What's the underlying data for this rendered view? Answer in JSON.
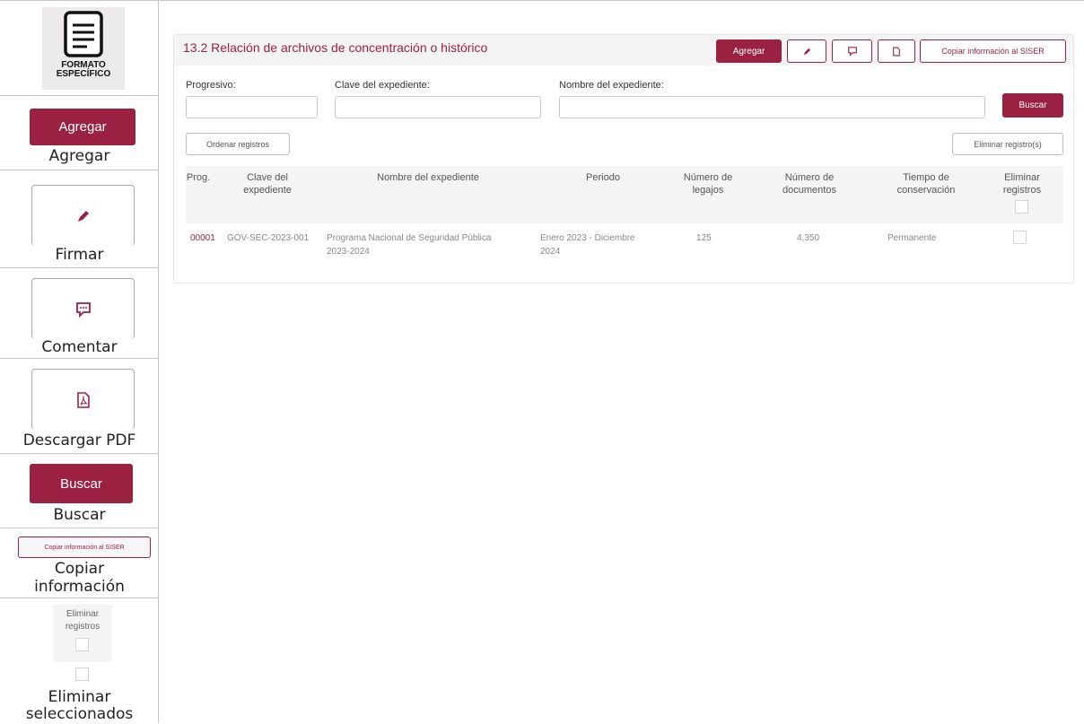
{
  "legend": {
    "format_icon_line1": "FORMATO",
    "format_icon_line2": "ESPECÍFICO",
    "agregar": {
      "button": "Agregar",
      "caption": "Agregar"
    },
    "firmar": {
      "caption": "Firmar"
    },
    "comentar": {
      "caption": "Comentar"
    },
    "pdf": {
      "caption": "Descargar PDF"
    },
    "buscar": {
      "button": "Buscar",
      "caption": "Buscar"
    },
    "copiar": {
      "button": "Copiar información al SISER",
      "caption_line1": "Copiar",
      "caption_line2": "información"
    },
    "eliminar": {
      "header_line1": "Eliminar",
      "header_line2": "registros",
      "caption_line1": "Eliminar",
      "caption_line2": "seleccionados"
    }
  },
  "panel": {
    "title": "13.2 Relación de archivos de concentración o histórico",
    "toolbar": {
      "agregar": "Agregar",
      "copiar": "Copiar información al SISER"
    },
    "filters": {
      "progresivo_label": "Progresivo:",
      "clave_label": "Clave del expediente:",
      "nombre_label": "Nombre del expediente:",
      "buscar": "Buscar"
    },
    "ordenar": "Ordenar registros",
    "eliminar": "Eliminar registro(s)",
    "columns": {
      "prog": "Prog.",
      "clave_1": "Clave del",
      "clave_2": "expediente",
      "nombre": "Nombre del expediente",
      "periodo": "Periodo",
      "legajos_1": "Número de",
      "legajos_2": "legajos",
      "docs_1": "Número de",
      "docs_2": "documentos",
      "tiempo_1": "Tiempo de",
      "tiempo_2": "conservación",
      "elim_1": "Eliminar",
      "elim_2": "registros"
    },
    "rows": [
      {
        "prog": "00001",
        "clave": "GOV-SEC-2023-001",
        "nombre_1": "Programa Nacional de Seguridad Pública",
        "nombre_2": "2023-2024",
        "periodo_1": "Enero 2023 - Diciembre",
        "periodo_2": "2024",
        "legajos": "125",
        "documentos": "4,350",
        "tiempo": "Permanente"
      }
    ]
  },
  "colors": {
    "accent": "#9b2143"
  }
}
